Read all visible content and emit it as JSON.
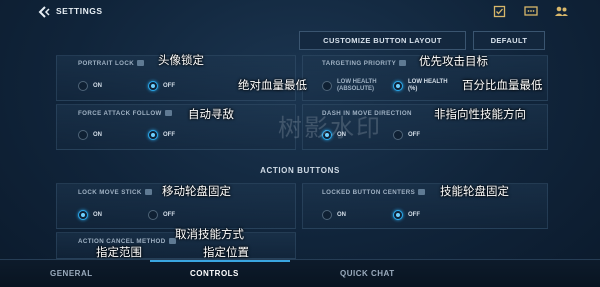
{
  "header": {
    "title": "SETTINGS",
    "icons": [
      "back-icon",
      "checklist-icon",
      "chat-icon",
      "friends-icon"
    ]
  },
  "toolbar": {
    "customize_label": "CUSTOMIZE BUTTON LAYOUT",
    "default_label": "DEFAULT"
  },
  "settings": {
    "portrait_lock": {
      "label": "PORTRAIT LOCK",
      "cn": "头像锁定",
      "on": "ON",
      "off": "OFF",
      "selected": "off"
    },
    "targeting_priority": {
      "label": "TARGETING PRIORITY",
      "cn": "优先攻击目标",
      "opt1_line1": "LOW HEALTH",
      "opt1_line2": "(ABSOLUTE)",
      "opt2_line1": "LOW HEALTH",
      "opt2_line2": "(%)",
      "cn_opt1": "绝对血量最低",
      "cn_opt2": "百分比血量最低",
      "selected": "opt2"
    },
    "force_attack_follow": {
      "label": "FORCE ATTACK FOLLOW",
      "cn": "自动寻敌",
      "on": "ON",
      "off": "OFF",
      "selected": "off"
    },
    "dash_in_move_direction": {
      "label": "DASH IN MOVE DIRECTION",
      "cn": "非指向性技能方向",
      "on": "ON",
      "off": "OFF",
      "selected": "on"
    }
  },
  "action_section": {
    "title": "ACTION BUTTONS",
    "lock_move_stick": {
      "label": "LOCK MOVE STICK",
      "cn": "移动轮盘固定",
      "on": "ON",
      "off": "OFF",
      "selected": "on"
    },
    "locked_button_centers": {
      "label": "LOCKED BUTTON CENTERS",
      "cn": "技能轮盘固定",
      "on": "ON",
      "off": "OFF",
      "selected": "off"
    },
    "action_cancel_method": {
      "label": "ACTION CANCEL METHOD",
      "cn": "取消技能方式",
      "cn_opt1": "指定范围",
      "cn_opt2": "指定位置"
    }
  },
  "watermark": "树影水印",
  "bottom_nav": {
    "items": [
      "GENERAL",
      "CONTROLS",
      "QUICK CHAT"
    ],
    "active": "CONTROLS"
  },
  "colors": {
    "accent": "#2aa6e8",
    "background": "#10243a"
  }
}
